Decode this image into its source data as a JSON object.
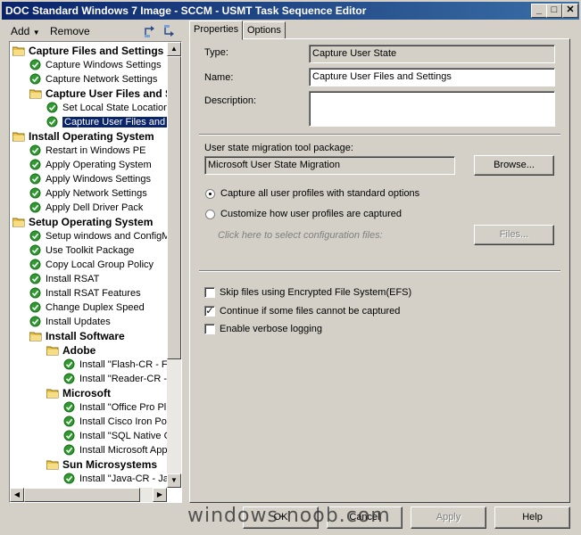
{
  "window": {
    "title": "DOC Standard Windows 7 Image - SCCM - USMT Task Sequence Editor",
    "controls": {
      "minimize": "_",
      "maximize": "□",
      "close": "✕"
    }
  },
  "toolbar": {
    "add_label": "Add",
    "remove_label": "Remove"
  },
  "tree": {
    "items": [
      {
        "label": "Capture Files and Settings",
        "type": "group",
        "level": 0
      },
      {
        "label": "Capture Windows Settings",
        "type": "step",
        "level": 1
      },
      {
        "label": "Capture Network Settings",
        "type": "step",
        "level": 1
      },
      {
        "label": "Capture User Files and S",
        "type": "group",
        "level": 1
      },
      {
        "label": "Set Local State Location",
        "type": "step",
        "level": 2
      },
      {
        "label": "Capture User Files and",
        "type": "step",
        "level": 2,
        "selected": true
      },
      {
        "label": "Install Operating System",
        "type": "group",
        "level": 0
      },
      {
        "label": "Restart in Windows PE",
        "type": "step",
        "level": 1
      },
      {
        "label": "Apply Operating System",
        "type": "step",
        "level": 1
      },
      {
        "label": "Apply Windows Settings",
        "type": "step",
        "level": 1
      },
      {
        "label": "Apply Network Settings",
        "type": "step",
        "level": 1
      },
      {
        "label": "Apply Dell Driver Pack",
        "type": "step",
        "level": 1
      },
      {
        "label": "Setup Operating System",
        "type": "group",
        "level": 0
      },
      {
        "label": "Setup windows and ConfigM",
        "type": "step",
        "level": 1
      },
      {
        "label": "Use Toolkit Package",
        "type": "step",
        "level": 1
      },
      {
        "label": "Copy Local Group Policy",
        "type": "step",
        "level": 1
      },
      {
        "label": "Install RSAT",
        "type": "step",
        "level": 1
      },
      {
        "label": "Install RSAT Features",
        "type": "step",
        "level": 1
      },
      {
        "label": "Change Duplex Speed",
        "type": "step",
        "level": 1
      },
      {
        "label": "Install Updates",
        "type": "step",
        "level": 1
      },
      {
        "label": "Install Software",
        "type": "group",
        "level": 1
      },
      {
        "label": "Adobe",
        "type": "group",
        "level": 2
      },
      {
        "label": "Install \"Flash-CR - F",
        "type": "step",
        "level": 3
      },
      {
        "label": "Install \"Reader-CR -",
        "type": "step",
        "level": 3
      },
      {
        "label": "Microsoft",
        "type": "group",
        "level": 2
      },
      {
        "label": "Install \"Office Pro Pl",
        "type": "step",
        "level": 3
      },
      {
        "label": "Install Cisco Iron Po",
        "type": "step",
        "level": 3
      },
      {
        "label": "Install \"SQL Native C",
        "type": "step",
        "level": 3
      },
      {
        "label": "Install Microsoft App",
        "type": "step",
        "level": 3
      },
      {
        "label": "Sun Microsystems",
        "type": "group",
        "level": 2
      },
      {
        "label": "Install \"Java-CR - Ja",
        "type": "step",
        "level": 3
      }
    ]
  },
  "tabs": [
    {
      "label": "Properties",
      "active": true
    },
    {
      "label": "Options",
      "active": false
    }
  ],
  "properties": {
    "type_label": "Type:",
    "type_value": "Capture User State",
    "name_label": "Name:",
    "name_value": "Capture User Files and Settings",
    "description_label": "Description:",
    "description_value": "",
    "package_label": "User state migration tool package:",
    "package_value": "Microsoft User State Migration",
    "browse_label": "Browse...",
    "radio_all_label": "Capture all user profiles with standard options",
    "radio_custom_label": "Customize how user profiles are captured",
    "config_files_label": "Click here to select configuration files:",
    "files_label": "Files...",
    "check_efs_label": "Skip files using Encrypted File System(EFS)",
    "check_continue_label": "Continue if some files cannot be captured",
    "check_verbose_label": "Enable verbose logging",
    "checkmark": "✓"
  },
  "footer": {
    "ok_label": "OK",
    "cancel_label": "Cancel",
    "apply_label": "Apply",
    "help_label": "Help"
  },
  "watermark": "windows-noob.com",
  "colors": {
    "title_bar": "#0a246a",
    "selection": "#0a246a",
    "step_ok": "#2e9b2e",
    "folder": "#e8c34a"
  }
}
